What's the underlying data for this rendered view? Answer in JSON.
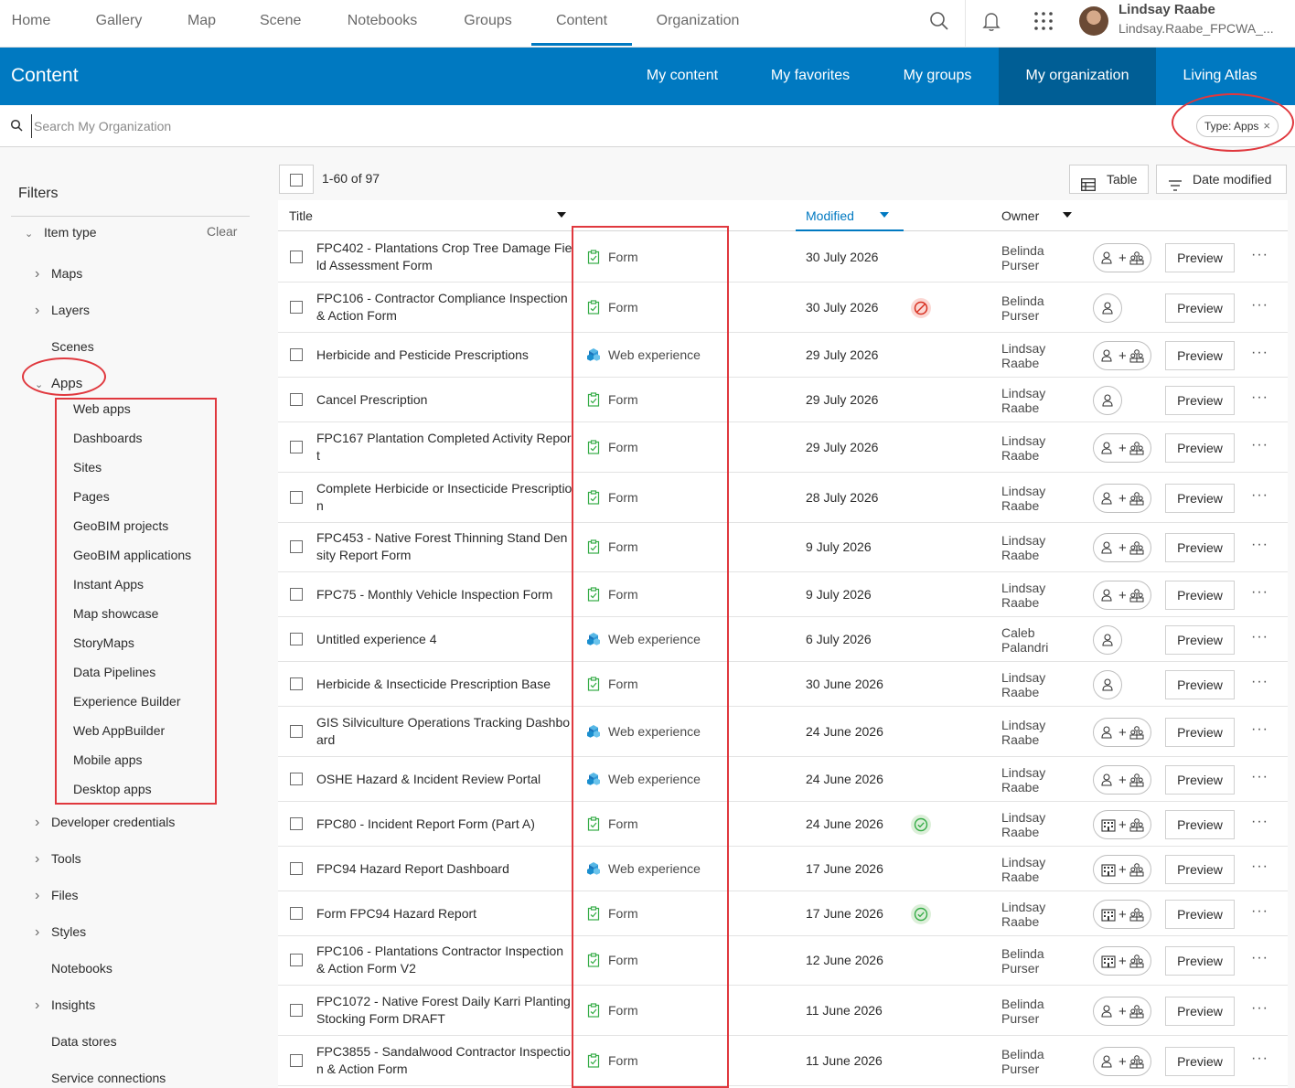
{
  "nav": {
    "items": [
      "Home",
      "Gallery",
      "Map",
      "Scene",
      "Notebooks",
      "Groups",
      "Content",
      "Organization"
    ],
    "active": "Content",
    "user_name": "Lindsay Raabe",
    "user_login": "Lindsay.Raabe_FPCWA_..."
  },
  "content_header": {
    "title": "Content",
    "tabs": [
      "My content",
      "My favorites",
      "My groups",
      "My organization",
      "Living Atlas"
    ],
    "active_tab": "My organization"
  },
  "search": {
    "placeholder": "Search My Organization",
    "chip_label": "Type: Apps"
  },
  "sidebar": {
    "title": "Filters",
    "item_type_label": "Item type",
    "clear_label": "Clear",
    "items_top": [
      "Maps",
      "Layers",
      "Scenes",
      "Apps"
    ],
    "apps_subitems": [
      "Web apps",
      "Dashboards",
      "Sites",
      "Pages",
      "GeoBIM projects",
      "GeoBIM applications",
      "Instant Apps",
      "Map showcase",
      "StoryMaps",
      "Data Pipelines",
      "Experience Builder",
      "Web AppBuilder",
      "Mobile apps",
      "Desktop apps"
    ],
    "items_bottom": [
      "Developer credentials",
      "Tools",
      "Files",
      "Styles",
      "Notebooks",
      "Insights",
      "Data stores",
      "Service connections"
    ]
  },
  "toolbar": {
    "count": "1-60 of 97",
    "table_label": "Table",
    "sort_label": "Date modified"
  },
  "table": {
    "headers": {
      "title": "Title",
      "modified": "Modified",
      "owner": "Owner"
    },
    "preview_label": "Preview",
    "more_label": "···",
    "rows": [
      {
        "title": "FPC402 - Plantations Crop Tree Damage Field Assessment Form",
        "type": "Form",
        "modified": "30 July 2026",
        "owner": "Belinda Purser",
        "status": "",
        "share": "org-groups"
      },
      {
        "title": "FPC106 - Contractor Compliance Inspection & Action Form",
        "type": "Form",
        "modified": "30 July 2026",
        "owner": "Belinda Purser",
        "status": "blocked",
        "share": "private"
      },
      {
        "title": "Herbicide and Pesticide Prescriptions",
        "type": "Web experience",
        "modified": "29 July 2026",
        "owner": "Lindsay Raabe",
        "status": "",
        "share": "org-groups"
      },
      {
        "title": "Cancel Prescription",
        "type": "Form",
        "modified": "29 July 2026",
        "owner": "Lindsay Raabe",
        "status": "",
        "share": "private"
      },
      {
        "title": "FPC167 Plantation Completed Activity Report",
        "type": "Form",
        "modified": "29 July 2026",
        "owner": "Lindsay Raabe",
        "status": "",
        "share": "org-groups"
      },
      {
        "title": "Complete Herbicide or Insecticide Prescription",
        "type": "Form",
        "modified": "28 July 2026",
        "owner": "Lindsay Raabe",
        "status": "",
        "share": "org-groups"
      },
      {
        "title": "FPC453 - Native Forest Thinning Stand Density Report Form",
        "type": "Form",
        "modified": "9 July 2026",
        "owner": "Lindsay Raabe",
        "status": "",
        "share": "org-groups"
      },
      {
        "title": "FPC75 - Monthly Vehicle Inspection Form",
        "type": "Form",
        "modified": "9 July 2026",
        "owner": "Lindsay Raabe",
        "status": "",
        "share": "org-groups"
      },
      {
        "title": "Untitled experience 4",
        "type": "Web experience",
        "modified": "6 July 2026",
        "owner": "Caleb Palandri",
        "status": "",
        "share": "private"
      },
      {
        "title": "Herbicide & Insecticide Prescription Base",
        "type": "Form",
        "modified": "30 June 2026",
        "owner": "Lindsay Raabe",
        "status": "",
        "share": "private"
      },
      {
        "title": "GIS Silviculture Operations Tracking Dashboard",
        "type": "Web experience",
        "modified": "24 June 2026",
        "owner": "Lindsay Raabe",
        "status": "",
        "share": "org-groups"
      },
      {
        "title": "OSHE Hazard & Incident Review Portal",
        "type": "Web experience",
        "modified": "24 June 2026",
        "owner": "Lindsay Raabe",
        "status": "",
        "share": "org-groups"
      },
      {
        "title": "FPC80 - Incident Report Form (Part A)",
        "type": "Form",
        "modified": "24 June 2026",
        "owner": "Lindsay Raabe",
        "status": "authoritative",
        "share": "building-groups"
      },
      {
        "title": "FPC94 Hazard Report Dashboard",
        "type": "Web experience",
        "modified": "17 June 2026",
        "owner": "Lindsay Raabe",
        "status": "",
        "share": "building-groups"
      },
      {
        "title": "Form FPC94 Hazard Report",
        "type": "Form",
        "modified": "17 June 2026",
        "owner": "Lindsay Raabe",
        "status": "authoritative",
        "share": "building-groups"
      },
      {
        "title": "FPC106 - Plantations Contractor Inspection & Action Form V2",
        "type": "Form",
        "modified": "12 June 2026",
        "owner": "Belinda Purser",
        "status": "",
        "share": "building-groups"
      },
      {
        "title": "FPC1072 - Native Forest Daily Karri Planting Stocking Form DRAFT",
        "type": "Form",
        "modified": "11 June 2026",
        "owner": "Belinda Purser",
        "status": "",
        "share": "org-groups"
      },
      {
        "title": "FPC3855 - Sandalwood Contractor Inspection & Action Form",
        "type": "Form",
        "modified": "11 June 2026",
        "owner": "Belinda Purser",
        "status": "",
        "share": "org-groups"
      }
    ]
  },
  "colors": {
    "brand_blue": "#0079c1",
    "active_tab_bg": "#005e95",
    "annotation_red": "#e0383e",
    "form_icon_green": "#35ac46",
    "status_blocked": "#d83020",
    "status_ok": "#35ac46"
  }
}
